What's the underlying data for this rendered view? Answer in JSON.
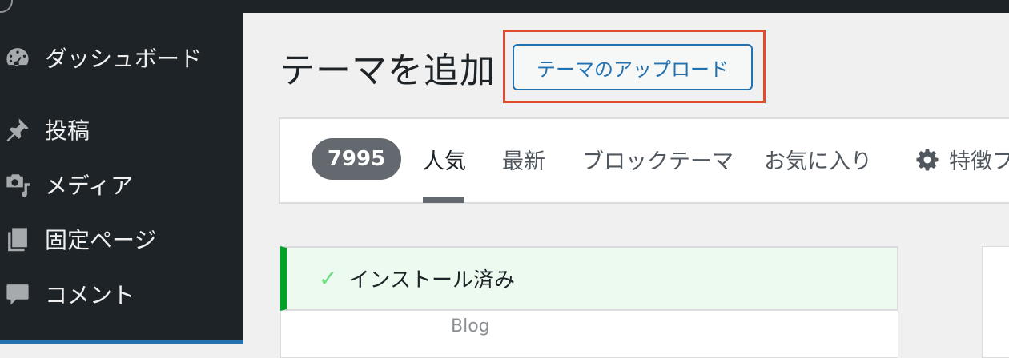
{
  "sidebar": {
    "items": [
      {
        "label": "ダッシュボード",
        "icon": "dashboard-icon"
      },
      {
        "label": "投稿",
        "icon": "pushpin-icon"
      },
      {
        "label": "メディア",
        "icon": "media-icon"
      },
      {
        "label": "固定ページ",
        "icon": "pages-icon"
      },
      {
        "label": "コメント",
        "icon": "comment-icon"
      }
    ]
  },
  "header": {
    "title": "テーマを追加",
    "upload_label": "テーマのアップロード"
  },
  "filter": {
    "count": "7995",
    "tabs": [
      {
        "label": "人気",
        "active": true
      },
      {
        "label": "最新",
        "active": false
      },
      {
        "label": "ブロックテーマ",
        "active": false
      },
      {
        "label": "お気に入り",
        "active": false
      }
    ],
    "features_label": "特徴フ",
    "features_icon": "gear-icon"
  },
  "theme_card": {
    "installed_label": "インストール済み",
    "category": "Blog"
  },
  "colors": {
    "admin_bar": "#1d2327",
    "accent": "#2271b1",
    "highlight": "#e04a2f",
    "installed_green": "#00a32a"
  }
}
